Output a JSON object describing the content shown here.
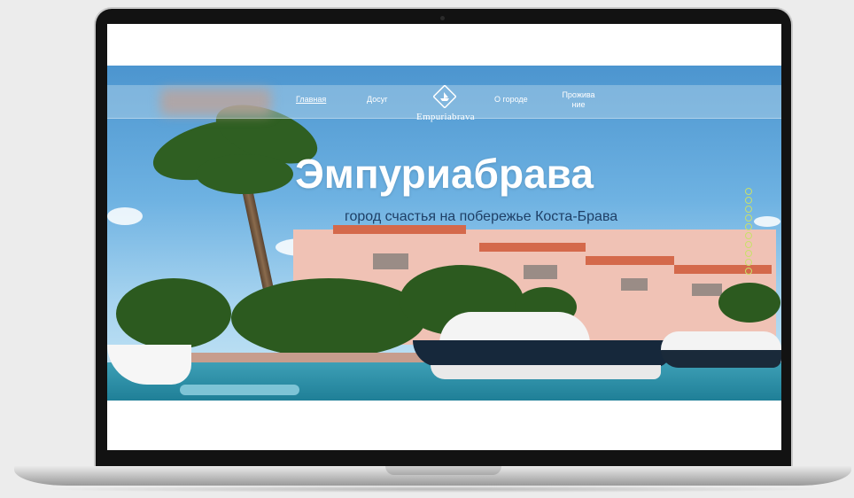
{
  "site": {
    "brand": "Empuriabrava",
    "nav": {
      "home": "Главная",
      "leisure": "Досуг",
      "about_city": "О городе",
      "living_line1": "Прожива",
      "living_line2": "ние"
    },
    "hero": {
      "title": "Эмпуриабрава",
      "subtitle": "город счастья на побережье Коста-Брава",
      "slider_dot_count": 10
    }
  },
  "colors": {
    "accent_dots": "#c9e06a",
    "subtitle": "#1e3f66"
  }
}
